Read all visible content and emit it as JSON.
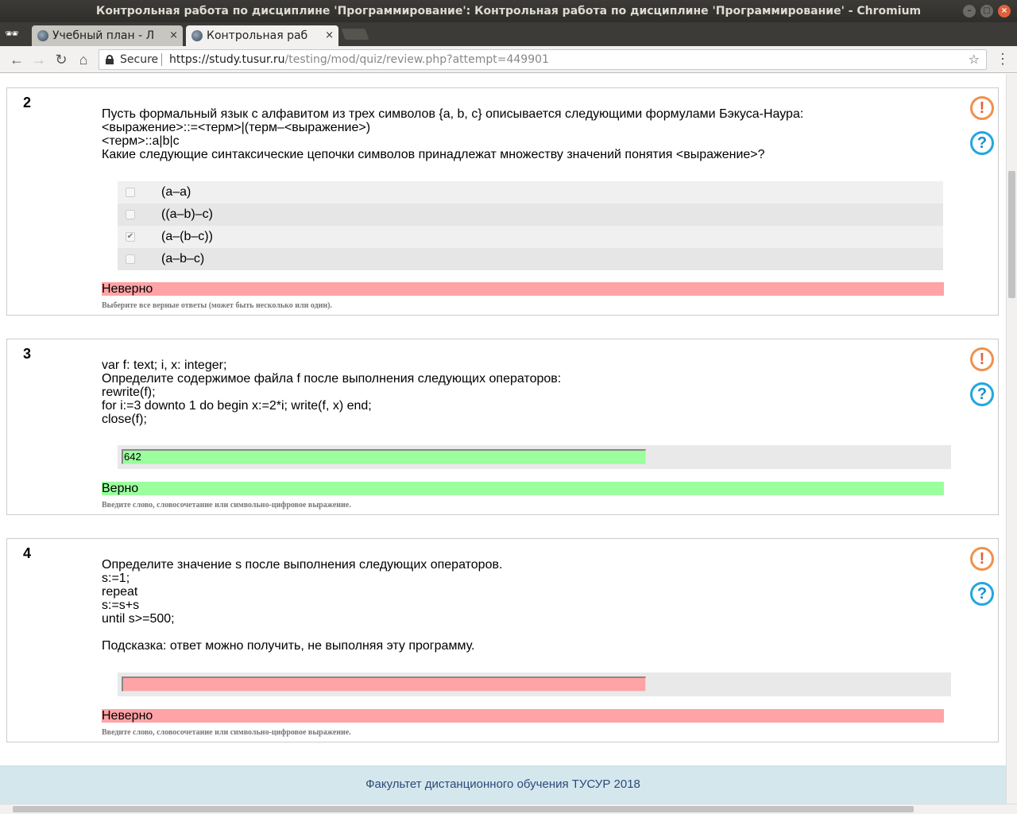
{
  "window": {
    "title": "Контрольная работа по дисциплине 'Программирование': Контрольная работа по дисциплине 'Программирование' - Chromium"
  },
  "tabs": [
    {
      "label": "Учебный план - Ли",
      "active": false
    },
    {
      "label": "Контрольная рабо",
      "active": true
    }
  ],
  "toolbar": {
    "secure_label": "Secure",
    "url_host": "https://study.tusur.ru",
    "url_path": "/testing/mod/quiz/review.php?attempt=449901"
  },
  "icons": {
    "flag": "exclamation-icon",
    "help": "question-icon",
    "tab_close": "×",
    "star": "☆",
    "menu": "⋮"
  },
  "questions": [
    {
      "number": "2",
      "text": "Пусть формальный язык с алфавитом из трех символов {a, b, c} описывается следующими формулами Бэкуса-Наура:\n<выражение>::=<терм>|(терм–<выражение>)\n<терм>::a|b|c\nКакие следующие синтаксические цепочки символов принадлежат множеству значений понятия <выражение>?",
      "options": [
        {
          "label": "(a–a)",
          "checked": false
        },
        {
          "label": "((a–b)–c)",
          "checked": false
        },
        {
          "label": "(a–(b–c))",
          "checked": true
        },
        {
          "label": "(a–b–c)",
          "checked": false
        }
      ],
      "result": "Неверно",
      "hint": "Выберите все верные ответы (может быть несколько или один)."
    },
    {
      "number": "3",
      "text": "var f: text; i, x: integer;\nОпределите содержимое файла f после выполнения следующих операторов:\nrewrite(f);\nfor i:=3 downto 1 do begin x:=2*i; write(f, x) end;\nclose(f);",
      "answer": "642",
      "result": "Верно",
      "hint": "Введите слово, словосочетание или символьно-цифровое выражение."
    },
    {
      "number": "4",
      "text": "Определите значение s после выполнения следующих операторов.\ns:=1;\nrepeat\ns:=s+s\nuntil s>=500;\n\nПодсказка: ответ можно получить, не выполняя эту программу.",
      "answer": "",
      "result": "Неверно",
      "hint": "Введите слово, словосочетание или символьно-цифровое выражение."
    }
  ],
  "footer": {
    "text": "Факультет дистанционного обучения ТУСУР 2018"
  }
}
